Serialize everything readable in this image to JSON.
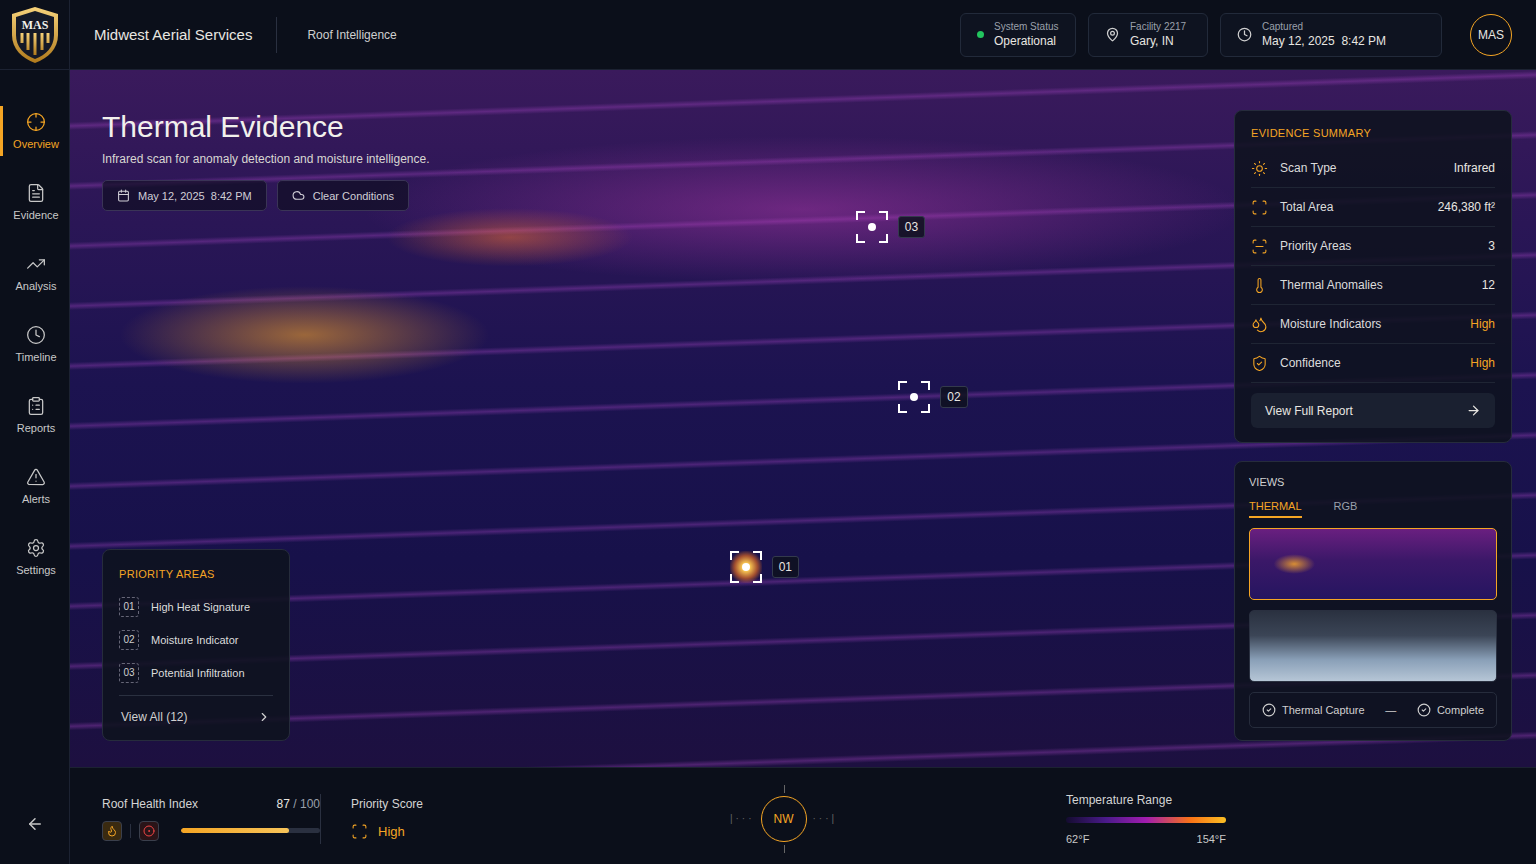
{
  "brand": {
    "logo": "MAS",
    "name": "Midwest Aerial Services",
    "section": "Roof Intelligence"
  },
  "header": {
    "status": {
      "label": "System Status",
      "value": "Operational",
      "color": "#22c55e"
    },
    "facility": {
      "label": "Facility 2217",
      "value": "Gary, IN"
    },
    "captured": {
      "label": "Captured",
      "value": "May 12, 2025  8:42 PM"
    },
    "avatar": "MAS"
  },
  "sidebar": {
    "items": [
      {
        "label": "Overview",
        "selected": true
      },
      {
        "label": "Evidence",
        "selected": false
      },
      {
        "label": "Analysis",
        "selected": false
      },
      {
        "label": "Timeline",
        "selected": false
      },
      {
        "label": "Reports",
        "selected": false
      },
      {
        "label": "Alerts",
        "selected": false
      },
      {
        "label": "Settings",
        "selected": false
      }
    ]
  },
  "page": {
    "title": "Thermal Evidence",
    "subtitle": "Infrared scan for anomaly detection and moisture intelligence.",
    "chips": [
      "May 12, 2025  8:42 PM",
      "Clear Conditions"
    ]
  },
  "markers": [
    {
      "number": "03",
      "hot": false
    },
    {
      "number": "02",
      "hot": false
    },
    {
      "number": "01",
      "hot": true
    }
  ],
  "priority_areas": {
    "title": "PRIORITY AREAS",
    "items": [
      {
        "number": "01",
        "label": "High Heat Signature"
      },
      {
        "number": "02",
        "label": "Moisture Indicator"
      },
      {
        "number": "03",
        "label": "Potential Infiltration"
      }
    ],
    "view_all": "View All (12)"
  },
  "summary": {
    "title": "EVIDENCE SUMMARY",
    "rows": [
      {
        "label": "Scan Type",
        "value": "Infrared",
        "emphasis": false
      },
      {
        "label": "Total Area",
        "value": "246,380 ft²",
        "emphasis": false
      },
      {
        "label": "Priority Areas",
        "value": "3",
        "emphasis": false
      },
      {
        "label": "Thermal Anomalies",
        "value": "12",
        "emphasis": false
      },
      {
        "label": "Moisture Indicators",
        "value": "High",
        "emphasis": true
      },
      {
        "label": "Confidence",
        "value": "High",
        "emphasis": true
      }
    ],
    "button": "View Full Report"
  },
  "views": {
    "title": "VIEWS",
    "tabs": [
      {
        "label": "THERMAL",
        "selected": true
      },
      {
        "label": "RGB",
        "selected": false
      }
    ],
    "thumbnails": [
      {
        "kind": "thermal",
        "selected": true
      },
      {
        "kind": "rgb",
        "selected": false
      }
    ],
    "steps": [
      {
        "label": "Thermal Capture",
        "done": true
      },
      {
        "label": "Complete",
        "done": true
      }
    ],
    "separator": "—"
  },
  "footer": {
    "health": {
      "label": "Roof Health Index",
      "value": "87",
      "max": "/ 100",
      "level": 0.78
    },
    "priority": {
      "label": "Priority Score",
      "value": "High"
    },
    "compass": {
      "label": "NW"
    },
    "temperature": {
      "label": "Temperature Range",
      "min": "62°F",
      "max": "154°F"
    }
  }
}
